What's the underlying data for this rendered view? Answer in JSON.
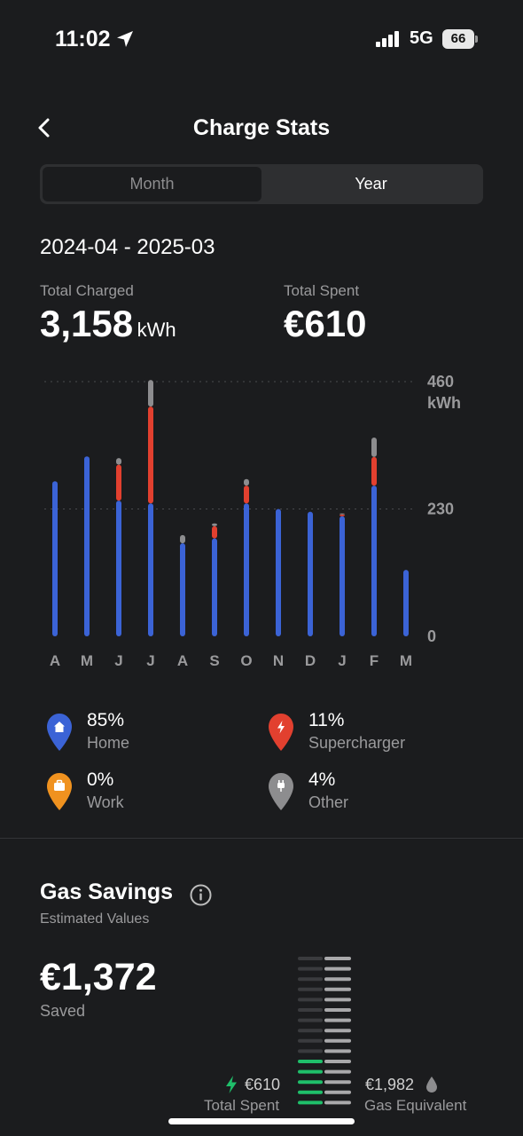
{
  "status_bar": {
    "time": "11:02",
    "network": "5G",
    "battery": "66"
  },
  "header": {
    "title": "Charge Stats"
  },
  "segment": {
    "options": [
      "Month",
      "Year"
    ],
    "selected": "Year"
  },
  "date_range": "2024-04 - 2025-03",
  "totals": {
    "charged_label": "Total Charged",
    "charged_value": "3,158",
    "charged_unit": "kWh",
    "spent_label": "Total Spent",
    "spent_value": "€610"
  },
  "chart_data": {
    "type": "bar",
    "stacked": true,
    "categories": [
      "A",
      "M",
      "J",
      "J",
      "A",
      "S",
      "O",
      "N",
      "D",
      "J",
      "F",
      "M"
    ],
    "series": [
      {
        "name": "Home",
        "color": "#3b63d6",
        "values": [
          280,
          325,
          245,
          240,
          168,
          177,
          240,
          230,
          225,
          217,
          272,
          120
        ]
      },
      {
        "name": "Supercharger",
        "color": "#e2402f",
        "values": [
          0,
          0,
          65,
          175,
          0,
          22,
          32,
          0,
          0,
          3,
          52,
          0
        ]
      },
      {
        "name": "Other",
        "color": "#8d8d8f",
        "values": [
          0,
          0,
          12,
          48,
          15,
          5,
          12,
          0,
          0,
          2,
          35,
          0
        ]
      }
    ],
    "ylim": [
      0,
      460
    ],
    "yticks": [
      "460",
      "230",
      "0"
    ],
    "yunit": "kWh"
  },
  "legend": [
    {
      "value": "85%",
      "name": "Home",
      "color": "#3b63d6",
      "icon": "house-icon"
    },
    {
      "value": "11%",
      "name": "Supercharger",
      "color": "#e2402f",
      "icon": "bolt-icon"
    },
    {
      "value": "0%",
      "name": "Work",
      "color": "#f0921f",
      "icon": "briefcase-icon"
    },
    {
      "value": "4%",
      "name": "Other",
      "color": "#8d8d8f",
      "icon": "plug-icon"
    }
  ],
  "gas_savings": {
    "title": "Gas Savings",
    "subtitle": "Estimated Values",
    "saved_value": "€1,372",
    "saved_label": "Saved",
    "spent_value": "€610",
    "spent_label": "Total Spent",
    "gas_value": "€1,982",
    "gas_label": "Gas Equivalent",
    "spent_fraction": 0.31
  }
}
